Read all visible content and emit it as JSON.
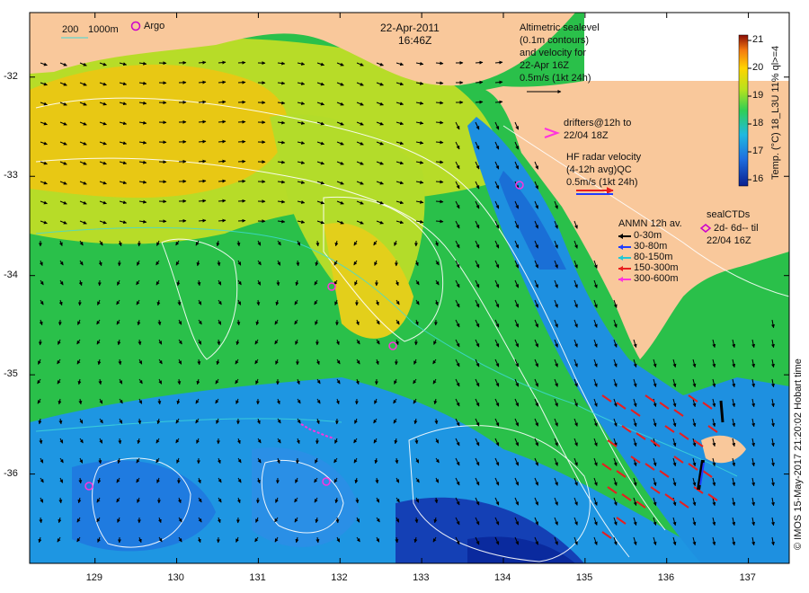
{
  "map": {
    "date": "22-Apr-2011",
    "time": "16:46Z",
    "lon_ticks": [
      129,
      130,
      131,
      132,
      133,
      134,
      135,
      136,
      137
    ],
    "lat_ticks": [
      -32,
      -33,
      -34,
      -35,
      -36
    ],
    "lon_range": [
      128.2,
      137.5
    ],
    "lat_range": [
      -36.9,
      -31.35
    ],
    "colors": {
      "land": "#f9c89b",
      "warm": "#f2c300",
      "mid": "#38c23a",
      "cool": "#1c8fe0",
      "cold": "#0a2a9e",
      "contour": "#ffffff",
      "arrow": "#000000",
      "hf_radar": "#e81e1e"
    }
  },
  "legend": {
    "depth": {
      "d200": "200",
      "d1000": "1000m"
    },
    "argo": "Argo",
    "altimetry": {
      "l1": "Altimetric sealevel",
      "l2": "(0.1m contours)",
      "l3": "and velocity for",
      "l4": "22-Apr 16Z",
      "l5": "0.5m/s (1kt 24h)"
    },
    "drifters": {
      "l1": "drifters@12h to",
      "l2": "22/04 18Z"
    },
    "hf_radar": {
      "l1": "HF radar velocity",
      "l2": "(4-12h avg)QC",
      "l3": "0.5m/s (1kt 24h)"
    },
    "anmn": {
      "title": "ANMN 12h av.",
      "items": [
        {
          "label": "0-30m",
          "color": "#000000"
        },
        {
          "label": "30-80m",
          "color": "#1f3cff"
        },
        {
          "label": "80-150m",
          "color": "#22c7d4"
        },
        {
          "label": "150-300m",
          "color": "#e81e1e"
        },
        {
          "label": "300-600m",
          "color": "#ff33dd"
        }
      ]
    },
    "seal": {
      "title": "sealCTDs",
      "l2": "2d- 6d-- til",
      "l3": "22/04 16Z"
    }
  },
  "colorbar": {
    "label": "Temp. (°C) 18_L3U 11% ql>=4",
    "ticks": [
      16,
      17,
      18,
      19,
      20,
      21
    ]
  },
  "credit": "© IMOS 15-May-2017 21:20:02 Hobart time"
}
